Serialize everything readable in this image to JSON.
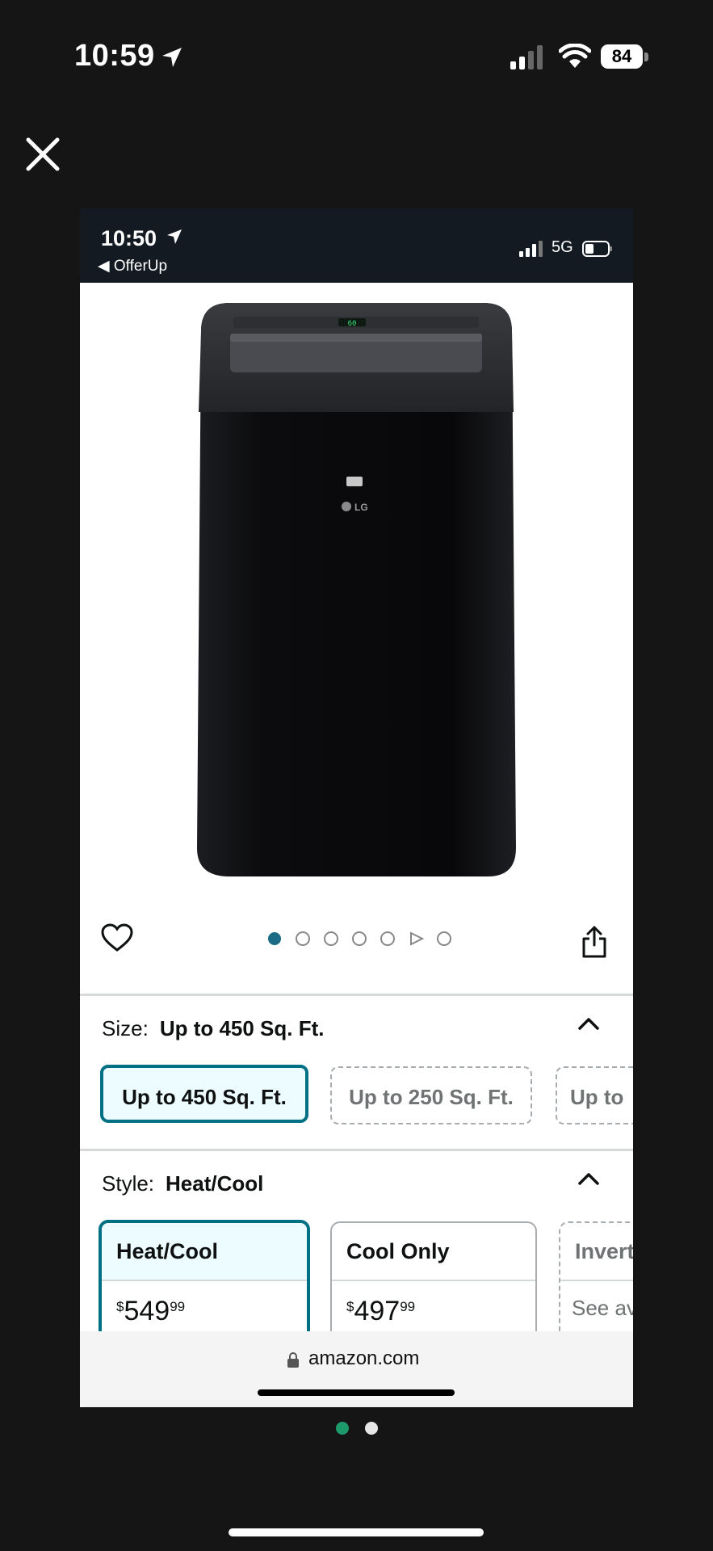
{
  "outer_status": {
    "time": "10:59",
    "battery": "84",
    "icons": [
      "location-arrow-icon",
      "cellular-signal-icon",
      "wifi-icon",
      "battery-icon"
    ]
  },
  "close_icon": "close-icon",
  "inner_status": {
    "time": "10:50",
    "back_label": "◀ OfferUp",
    "network": "5G"
  },
  "product": {
    "image_icon": "portable-air-conditioner-image",
    "brand_mark": "LG",
    "display_readout": "60",
    "gallery_total": 7,
    "gallery_active_index": 0,
    "gallery_video_index": 5
  },
  "size": {
    "label": "Size:",
    "selected": "Up to 450 Sq. Ft.",
    "options": [
      "Up to 450 Sq. Ft.",
      "Up to 250 Sq. Ft.",
      "Up to"
    ]
  },
  "style": {
    "label": "Style:",
    "selected": "Heat/Cool",
    "options": [
      {
        "name": "Heat/Cool",
        "price_symbol": "$",
        "price_whole": "549",
        "price_fraction": "99"
      },
      {
        "name": "Cool Only",
        "price_symbol": "$",
        "price_whole": "497",
        "price_fraction": "99"
      },
      {
        "name": "Invert",
        "availability": "See av"
      }
    ]
  },
  "browser": {
    "url": "amazon.com"
  },
  "pager": {
    "count": 2,
    "active_index": 0,
    "active_color": "#1d9a6c",
    "inactive_color": "#e6e6e6"
  },
  "colors": {
    "selected_border": "#007185",
    "selected_fill": "#edfdff",
    "gallery_active": "#1a6b86"
  }
}
